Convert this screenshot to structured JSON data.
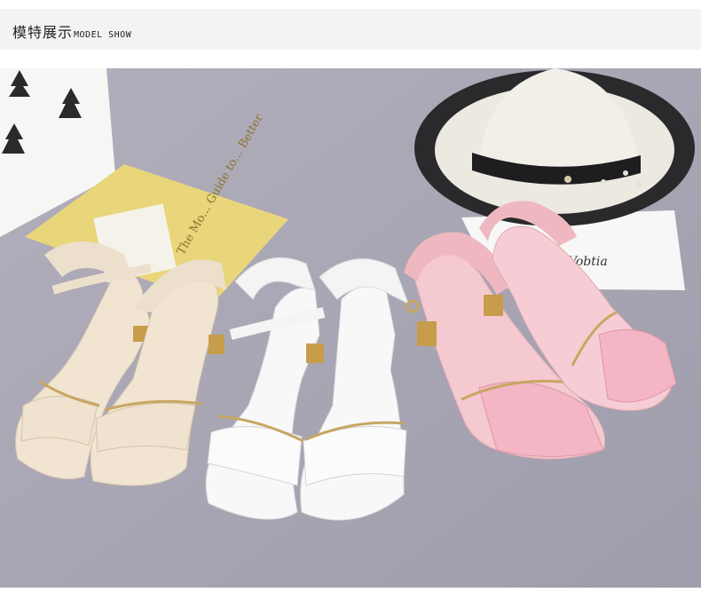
{
  "header": {
    "title_cn": "模特展示",
    "title_en": "MODEL SHOW"
  },
  "photo": {
    "book_text": "The Mo... Guide to... Better",
    "postcard_text": "Vobtia",
    "colors": {
      "table": "#aaa7b4",
      "beige": "#efe3d2",
      "white": "#f7f7f7",
      "pink": "#f2b6c3",
      "gold": "#c8a662"
    }
  }
}
